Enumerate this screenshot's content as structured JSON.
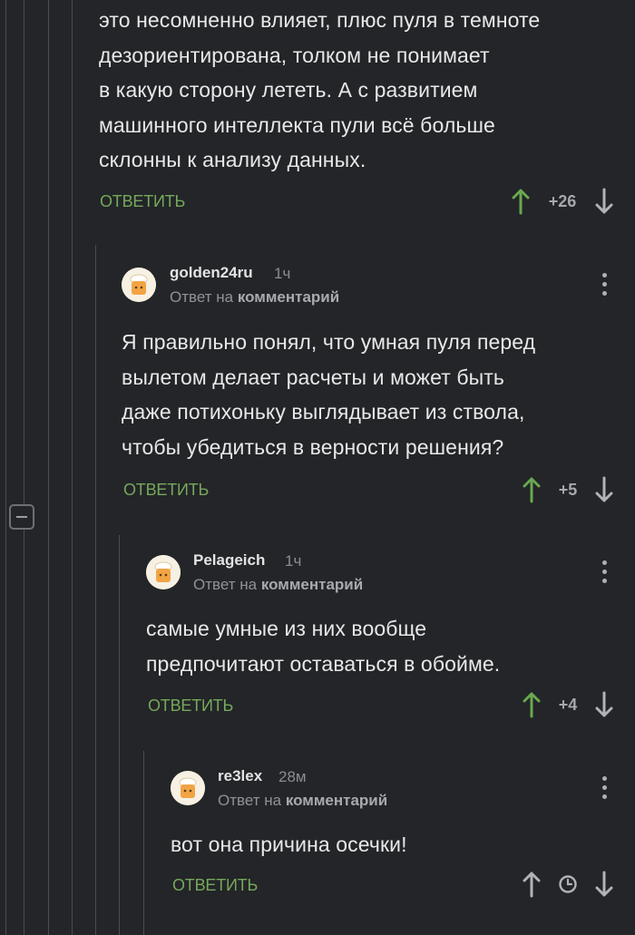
{
  "first_comment": {
    "text_lines": [
      "это несомненно влияет, плюс пуля в темноте",
      "дезориентирована, толком не понимает",
      "в какую сторону лететь. А с развитием",
      "машинного интеллекта пули всё больше",
      "склонны к анализу данных."
    ],
    "reply_label": "ОТВЕТИТЬ",
    "score": "+26"
  },
  "comments": [
    {
      "username": "golden24ru",
      "time": "1ч",
      "reply_prefix": "Ответ на",
      "reply_target": "комментарий",
      "text_lines": [
        "Я правильно понял, что умная пуля перед",
        "вылетом делает расчеты и может быть",
        "даже потихоньку выглядывает из ствола,",
        "чтобы убедиться в верности решения?"
      ],
      "reply_label": "ОТВЕТИТЬ",
      "score": "+5"
    },
    {
      "username": "Pelageich",
      "time": "1ч",
      "reply_prefix": "Ответ на",
      "reply_target": "комментарий",
      "text_lines": [
        "самые умные из них вообще",
        "предпочитают оставаться в обойме."
      ],
      "reply_label": "ОТВЕТИТЬ",
      "score": "+4"
    },
    {
      "username": "re3lex",
      "time": "28м",
      "reply_prefix": "Ответ на",
      "reply_target": "комментарий",
      "text_lines": [
        "вот она причина осечки!"
      ],
      "reply_label": "ОТВЕТИТЬ"
    }
  ],
  "colors": {
    "background": "#232528",
    "reply_link": "#76a85b",
    "upvote_arrow": "#6aa84f",
    "downvote_arrow": "#b0b3b7"
  },
  "icons": [
    "arrow-up-icon",
    "arrow-down-icon",
    "clock-icon",
    "more-vertical-icon",
    "collapse-minus-icon",
    "chef-avatar-icon"
  ]
}
